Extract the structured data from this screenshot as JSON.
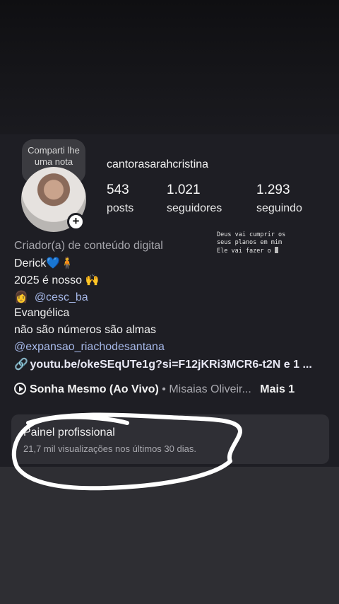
{
  "note": {
    "text": "Comparti lhe uma nota"
  },
  "profile": {
    "username": "cantorasarahcristina",
    "stats": [
      {
        "value": "543",
        "label": "posts"
      },
      {
        "value": "1.021",
        "label": "seguidores"
      },
      {
        "value": "1.293",
        "label": "seguindo"
      }
    ],
    "avatar_plus": "+"
  },
  "overlay_note": {
    "line1": "Deus vai cumprir os",
    "line2": "seus planos em mim",
    "line3": "Ele vai fazer o"
  },
  "bio": {
    "category": "Criador(a) de conteúdo digital",
    "line1": "Derick💙🧍",
    "line2": "2025 é nosso 🙌",
    "line3_emoji": "👩",
    "line3_mention": "@cesc_ba",
    "line4": "Evangélica",
    "line5": "não são números são almas",
    "line6_mention": "@expansao_riachodesantana",
    "link": "youtu.be/okeSEqUTe1g?si=F12jKRi3MCR6-t2N e 1 ...",
    "link_icon": "🔗"
  },
  "music": {
    "song": "Sonha Mesmo (Ao Vivo)",
    "separator": " • ",
    "artist": "Misaias Oliveir...",
    "more": "Mais 1"
  },
  "panel": {
    "title": "Painel profissional",
    "subtitle": "21,7 mil visualizações nos últimos 30 dias."
  },
  "colors": {
    "background": "#1e1e24",
    "mention": "#a6b8e8",
    "secondary_text": "#a8a8ae",
    "scribble": "#ffffff"
  }
}
